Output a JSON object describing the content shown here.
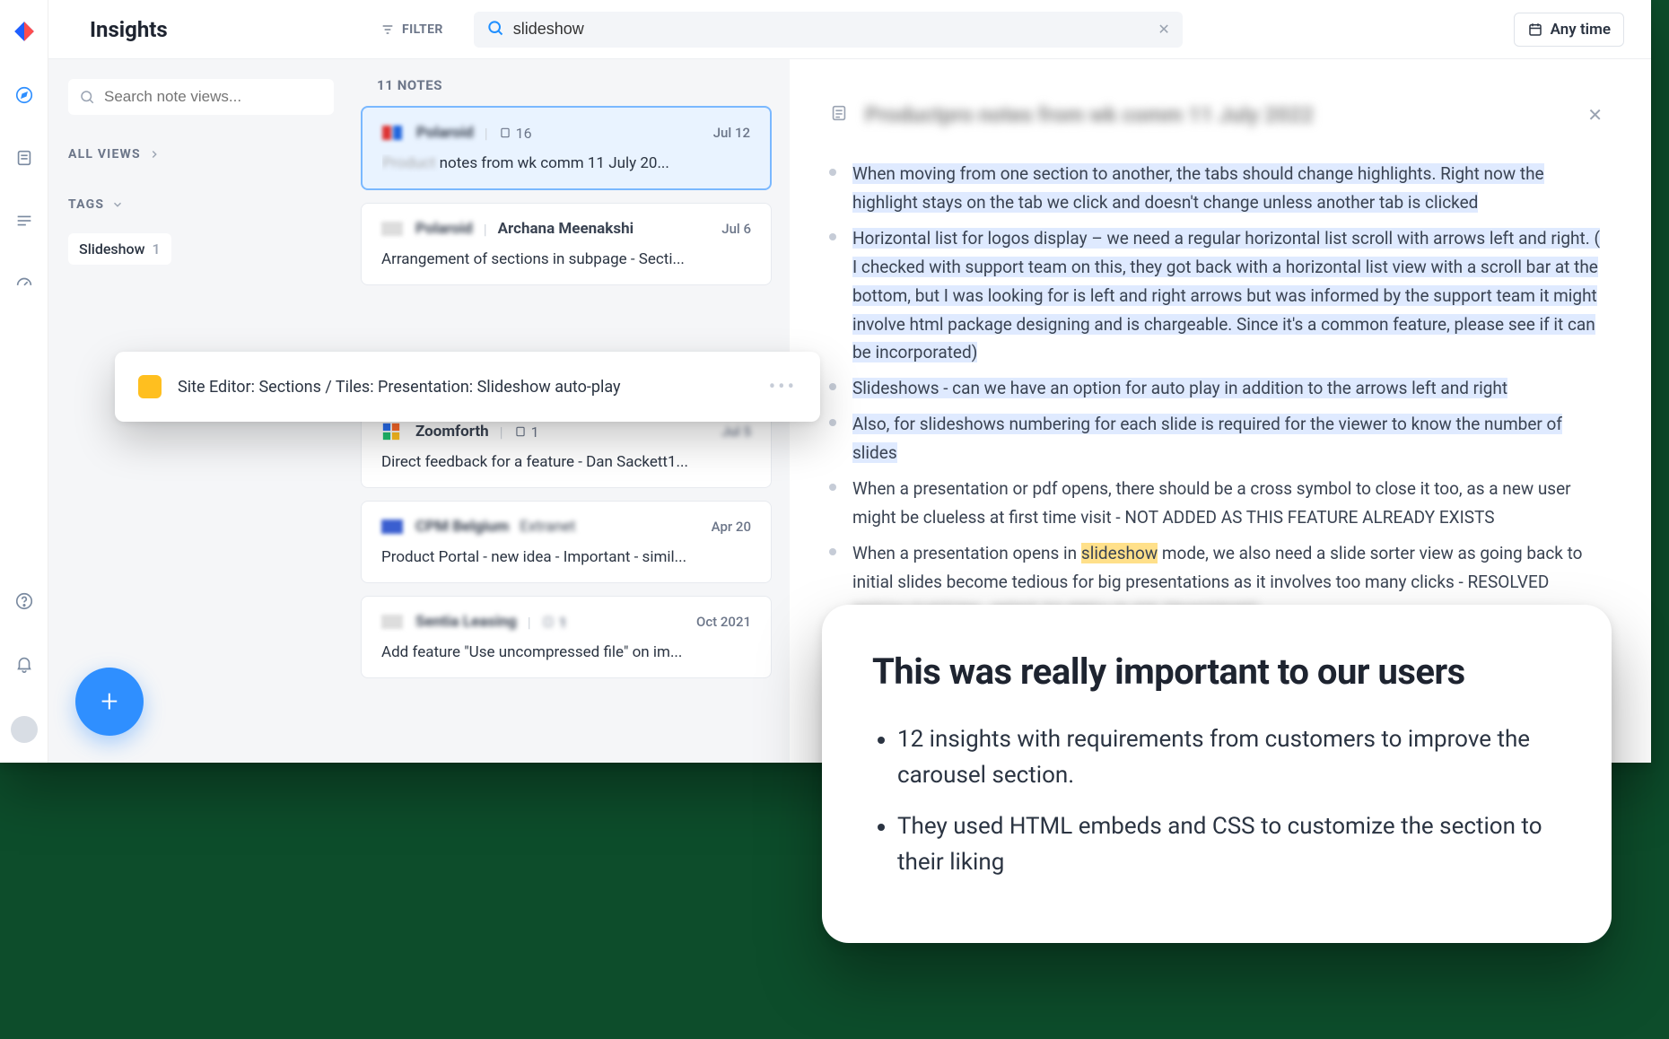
{
  "header": {
    "title": "Insights",
    "filter_label": "FILTER",
    "search_value": "slideshow",
    "anytime_label": "Any time"
  },
  "sidebar_views": {
    "search_placeholder": "Search note views...",
    "all_views_label": "ALL VIEWS",
    "tags_label": "TAGS",
    "tag": {
      "name": "Slideshow",
      "count": "1"
    }
  },
  "notes": {
    "count_label": "11 NOTES",
    "items": [
      {
        "author_blurred": "Polaroid",
        "file_count": "16",
        "date": "Jul 12",
        "title_prefix_blurred": "Product ",
        "title": "notes from wk comm 11 July 20...",
        "selected": true
      },
      {
        "author": "Archana Meenakshi",
        "date": "Jul 6",
        "title": "Arrangement of sections in subpage - Secti..."
      },
      {
        "author": "Zoomforth",
        "file_count": "1",
        "date_blurred": true,
        "date": "Jul 5",
        "title": "Direct feedback for a feature - Dan Sackett1..."
      },
      {
        "author_blurred": "CPM Belgium",
        "extra_blurred": "Extranet",
        "date": "Apr 20",
        "title": "Product Portal - new idea - Important - simil..."
      },
      {
        "author_blurred": "Sentia Leasing",
        "file_count_blurred": true,
        "file_count": "1",
        "date": "Oct 2021",
        "title": "Add feature \"Use uncompressed file\" on im..."
      }
    ]
  },
  "popover": {
    "text": "Site Editor: Sections / Tiles: Presentation: Slideshow auto-play"
  },
  "detail": {
    "title_blurred": "Productpro  notes from wk comm 11 July 2022",
    "bullets": [
      {
        "text": "When moving from one section to another, the tabs should change highlights. Right now the highlight stays on the tab we click and doesn't change unless another tab is clicked",
        "highlight": true
      },
      {
        "text": "Horizontal list for logos display – we need a regular horizontal list scroll with arrows left and right. ( I checked with support team on this, they got back with a horizontal list view with a scroll bar at the bottom, but I was looking for is left and right arrows but was informed by the support team it might involve html package designing and is chargeable. Since it's a common feature, please see if it can be incorporated)",
        "highlight": true
      },
      {
        "text": "Slideshows - can we have an option for auto play in addition to the arrows left and right",
        "highlight": true
      },
      {
        "text": "Also, for slideshows numbering for each slide is required for the viewer to know the number of slides",
        "highlight": true
      },
      {
        "text": "When a presentation or pdf opens, there should be a cross symbol to close it too, as a new user might be clueless at first time visit - NOT ADDED AS THIS FEATURE ALREADY EXISTS",
        "highlight": false
      },
      {
        "text_pre": "When a presentation opens in ",
        "text_mark": "slideshow",
        "text_post": " mode, we also need a slide sorter view as going back to initial slides become tedious for big presentations as it involves too many clicks - RESOLVED",
        "highlight": false
      }
    ],
    "trailing_blur": "WITCH CUSTOM - WENT TO PREV SLIDE TRANSPORT"
  },
  "overlay": {
    "heading": "This was really important to our users",
    "bullets": [
      "12 insights with requirements from customers to improve the carousel section.",
      "They used HTML embeds and CSS to customize the section to their liking"
    ]
  },
  "colors": {
    "accent": "#2f8fff",
    "highlight_bg": "#dfeaff",
    "mark_bg": "#ffe08a",
    "tag_yellow": "#ffbf1f"
  }
}
